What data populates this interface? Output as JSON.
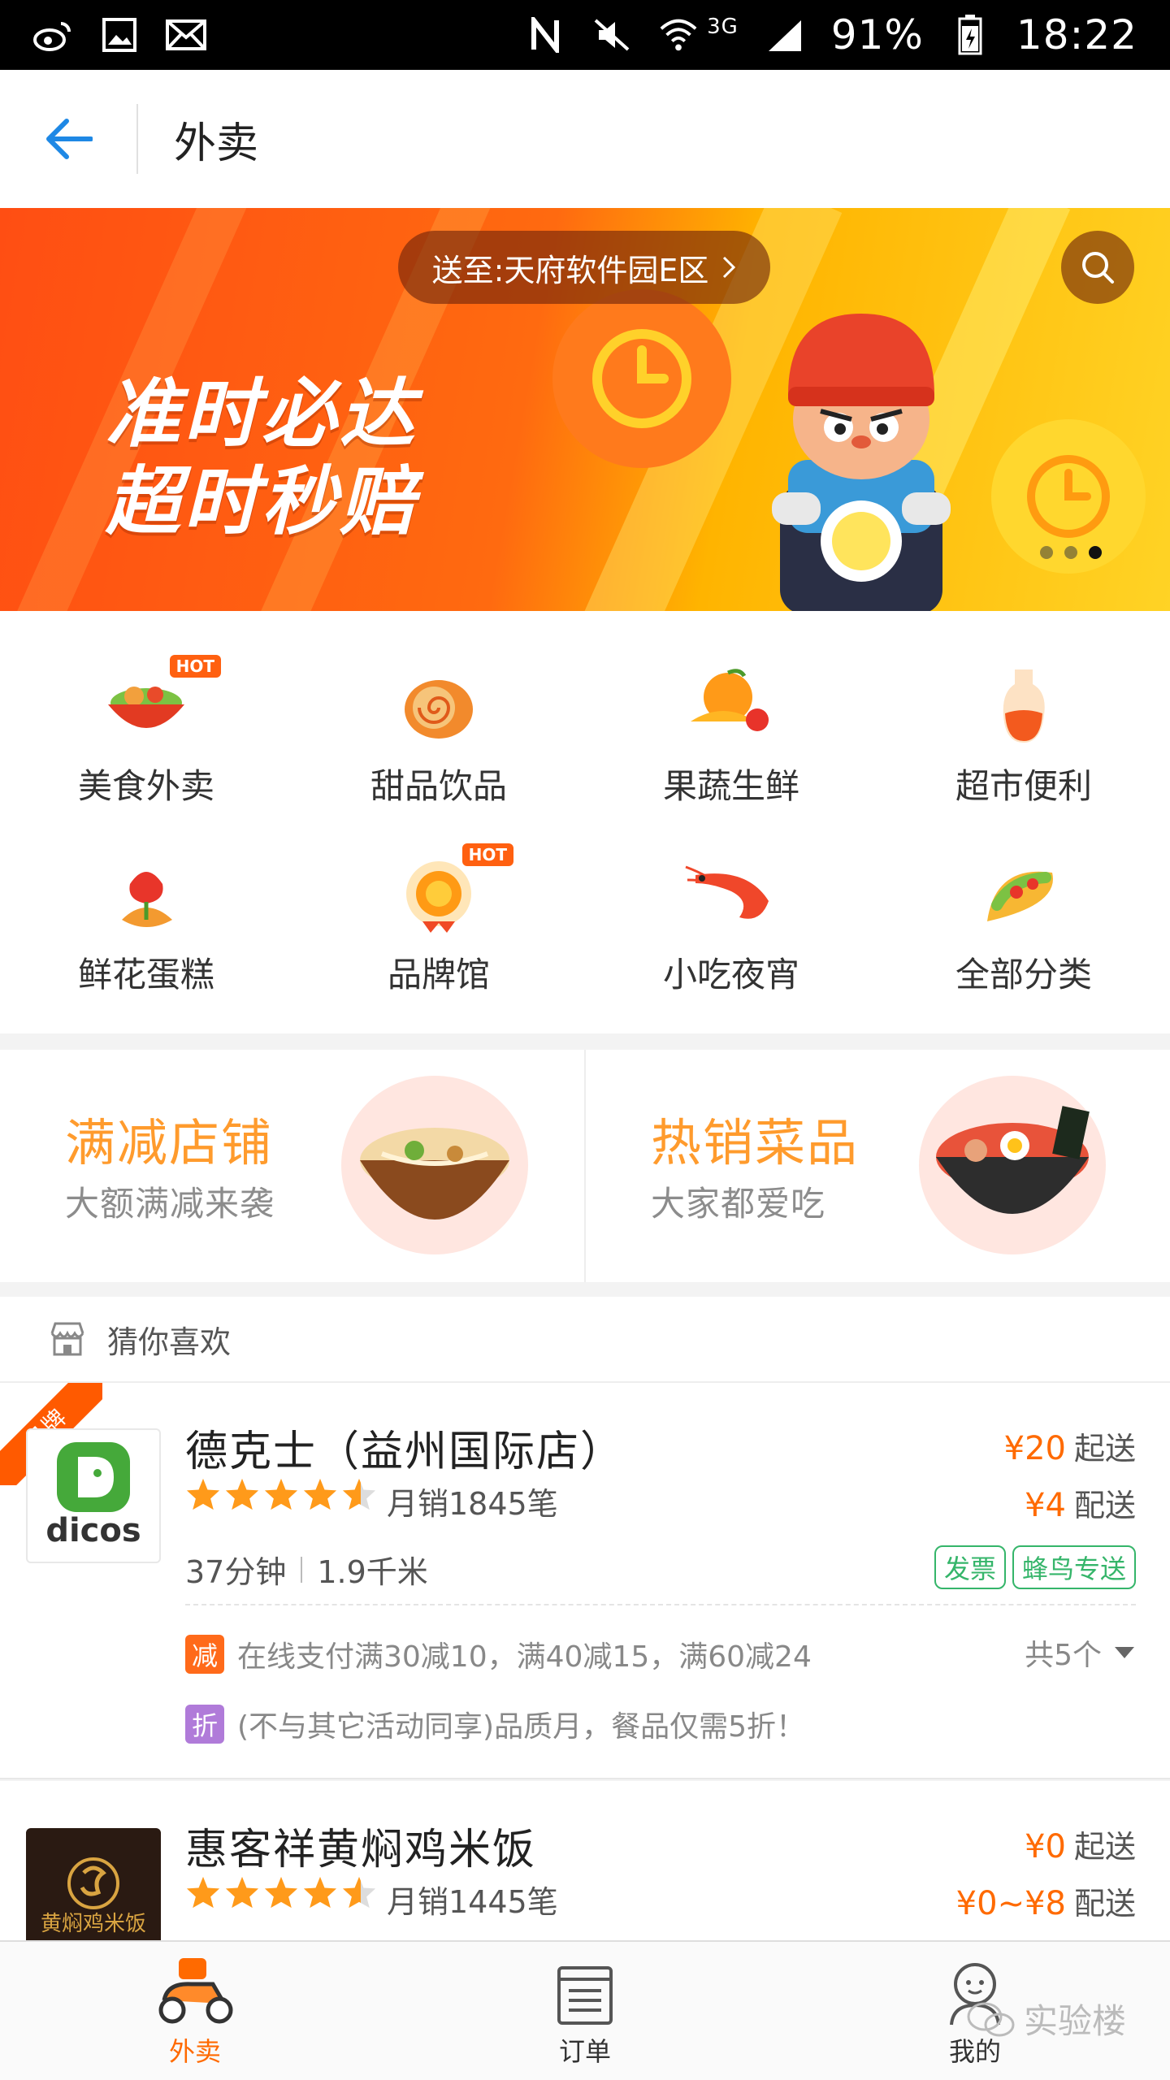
{
  "status_bar": {
    "battery": "91%",
    "time": "18:22",
    "network": "3G",
    "icons": [
      "weibo-icon",
      "image-icon",
      "mail-icon",
      "nfc-icon",
      "mute-icon",
      "wifi-icon",
      "signal-icon",
      "battery-icon"
    ]
  },
  "header": {
    "title": "外卖"
  },
  "banner": {
    "location": "送至:天府软件园E区",
    "slogan_line1": "准时必达",
    "slogan_line2": "超时秒赔"
  },
  "categories": [
    {
      "label": "美食外卖",
      "hot": "HOT",
      "icon": "food-bowl-icon"
    },
    {
      "label": "甜品饮品",
      "icon": "cake-roll-icon"
    },
    {
      "label": "果蔬生鲜",
      "icon": "fruit-icon"
    },
    {
      "label": "超市便利",
      "icon": "bottle-icon"
    },
    {
      "label": "鲜花蛋糕",
      "icon": "flower-icon"
    },
    {
      "label": "品牌馆",
      "hot": "HOT",
      "icon": "brand-medal-icon"
    },
    {
      "label": "小吃夜宵",
      "icon": "shrimp-icon"
    },
    {
      "label": "全部分类",
      "icon": "taco-icon"
    }
  ],
  "promos": [
    {
      "title": "满减店铺",
      "subtitle": "大额满减来袭"
    },
    {
      "title": "热销菜品",
      "subtitle": "大家都爱吃"
    }
  ],
  "section": {
    "title": "猜你喜欢"
  },
  "stores": [
    {
      "ribbon": "品牌",
      "logo_text": "dicos",
      "name": "德克士（益州国际店）",
      "rating": 4.5,
      "monthly_sales": "月销1845笔",
      "min_price": "¥20",
      "min_label": "起送",
      "delivery_price": "¥4",
      "delivery_label": "配送",
      "time": "37分钟",
      "distance": "1.9千米",
      "tags": [
        "发票",
        "蜂鸟专送"
      ],
      "activities": [
        {
          "badge": "减",
          "color": "#ff6a1a",
          "text": "在线支付满30减10，满40减15，满60减24"
        },
        {
          "badge": "折",
          "color": "#b07bd9",
          "text": "(不与其它活动同享)品质月，餐品仅需5折！"
        }
      ],
      "activity_count": "共5个"
    },
    {
      "logo_text": "黄焖鸡米饭",
      "name": "惠客祥黄焖鸡米饭",
      "rating": 4.5,
      "monthly_sales": "月销1445笔",
      "min_price": "¥0",
      "min_label": "起送",
      "delivery_price": "¥0~¥8",
      "delivery_label": "配送"
    }
  ],
  "bottom_nav": [
    {
      "label": "外卖",
      "active": true,
      "icon": "scooter-icon"
    },
    {
      "label": "订单",
      "active": false,
      "icon": "order-list-icon"
    },
    {
      "label": "我的",
      "active": false,
      "icon": "profile-icon"
    }
  ],
  "watermark": "实验楼",
  "colors": {
    "accent": "#ff6a00",
    "link_blue": "#1e88e5",
    "green_tag": "#35b56a"
  }
}
